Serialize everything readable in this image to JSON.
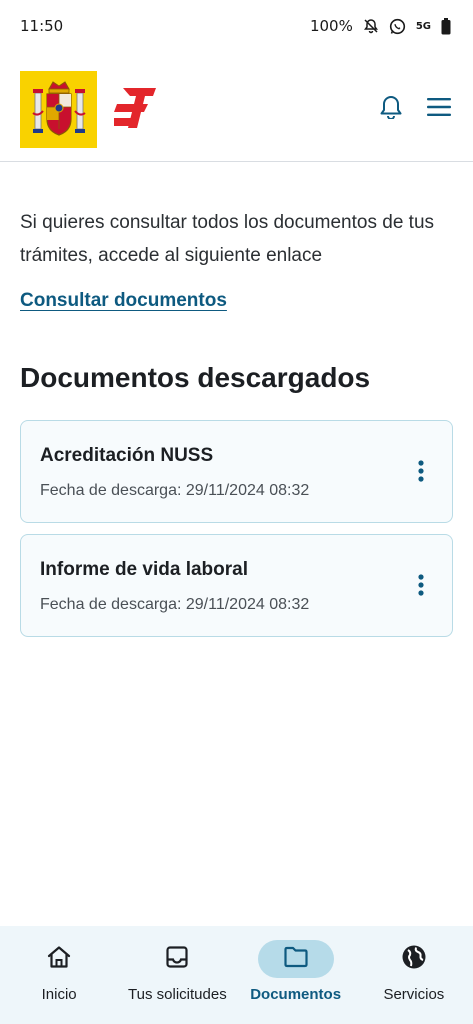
{
  "status_bar": {
    "time": "11:50",
    "battery": "100%",
    "network": "5G",
    "icons": [
      "bell-off-icon",
      "whatsapp-icon",
      "battery-icon"
    ]
  },
  "header": {
    "icons": [
      "coat-of-arms-logo",
      "seguridad-social-logo",
      "bell-icon",
      "menu-icon"
    ],
    "colors": {
      "coat_bg": "#f9d200",
      "brand_red": "#e3262b",
      "accent": "#0e5a80"
    }
  },
  "main": {
    "intro": "Si quieres consultar todos los documentos de tus trámites, accede al siguiente enlace",
    "link_label": "Consultar documentos",
    "section_title": "Documentos descargados",
    "documents": [
      {
        "title": "Acreditación NUSS",
        "date": "Fecha de descarga: 29/11/2024 08:32"
      },
      {
        "title": "Informe de vida laboral",
        "date": "Fecha de descarga: 29/11/2024 08:32"
      }
    ]
  },
  "bottom_nav": {
    "items": [
      {
        "label": "Inicio",
        "icon": "home-icon"
      },
      {
        "label": "Tus solicitudes",
        "icon": "inbox-icon"
      },
      {
        "label": "Documentos",
        "icon": "folder-icon"
      },
      {
        "label": "Servicios",
        "icon": "globe-icon"
      }
    ],
    "active": "Documentos"
  }
}
